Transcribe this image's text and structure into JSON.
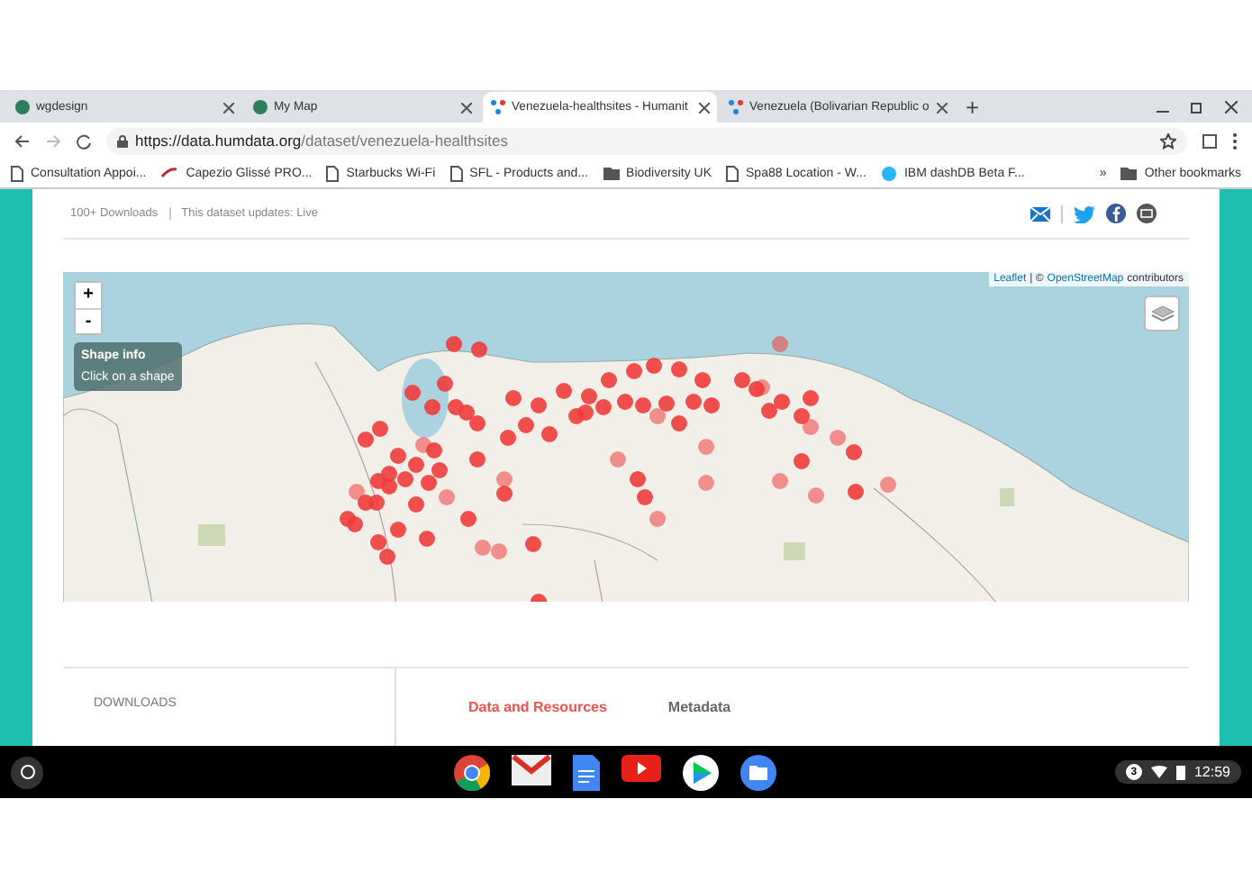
{
  "browser": {
    "tabs": [
      {
        "title": "wgdesign",
        "kind": "globe",
        "selected": false
      },
      {
        "title": "My Map",
        "kind": "globe",
        "selected": false
      },
      {
        "title": "Venezuela-healthsites - Humanit",
        "kind": "hdx",
        "selected": true
      },
      {
        "title": "Venezuela (Bolivarian Republic o",
        "kind": "hdx",
        "selected": false
      }
    ],
    "new_tab": "+",
    "url": {
      "host": "https://data.humdata.org",
      "path": "/dataset/venezuela-healthsites"
    },
    "bookmarks": [
      {
        "label": "Consultation Appoi...",
        "kind": "page"
      },
      {
        "label": "Capezio Glissé PRO...",
        "kind": "swoosh"
      },
      {
        "label": "Starbucks Wi-Fi",
        "kind": "page"
      },
      {
        "label": "SFL - Products and...",
        "kind": "page"
      },
      {
        "label": "Biodiversity UK",
        "kind": "folder"
      },
      {
        "label": "Spa88 Location - W...",
        "kind": "page"
      },
      {
        "label": "IBM dashDB Beta F...",
        "kind": "db"
      }
    ],
    "more_bookmarks": "»",
    "other_bookmarks": "Other bookmarks"
  },
  "dataset": {
    "downloads": "100+ Downloads",
    "updates": "This dataset updates: Live"
  },
  "map": {
    "zoom_in": "+",
    "zoom_out": "-",
    "info_title": "Shape info",
    "info_text": "Click on a shape",
    "attribution": {
      "link_1": "Leaflet",
      "separator": "| ©",
      "link_2": "OpenStreetMap",
      "suffix": "contributors"
    }
  },
  "section": {
    "sidebar_title": "DOWNLOADS",
    "tabs": [
      {
        "label": "Data and Resources",
        "selected": true
      },
      {
        "label": "Metadata",
        "selected": false
      }
    ]
  },
  "shelf": {
    "notifications": "3",
    "time": "12:59"
  }
}
